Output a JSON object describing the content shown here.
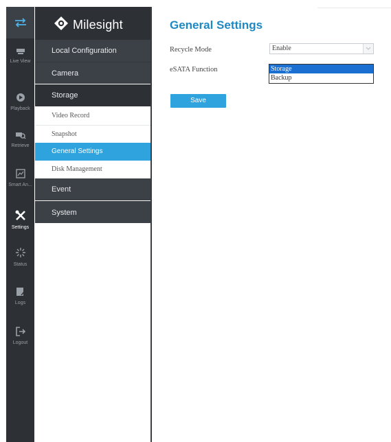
{
  "brand": {
    "name": "Milesight"
  },
  "rail": {
    "items": [
      {
        "label": "Live View",
        "icon": "live-view-icon"
      },
      {
        "label": "Playback",
        "icon": "playback-icon"
      },
      {
        "label": "Retrieve",
        "icon": "retrieve-icon"
      },
      {
        "label": "Smart An...",
        "icon": "smart-analysis-icon"
      },
      {
        "label": "Settings",
        "icon": "settings-icon",
        "active": true
      },
      {
        "label": "Status",
        "icon": "status-icon"
      },
      {
        "label": "Logs",
        "icon": "logs-icon"
      },
      {
        "label": "Logout",
        "icon": "logout-icon"
      }
    ]
  },
  "menu": {
    "groups": {
      "local_configuration": "Local Configuration",
      "camera": "Camera",
      "storage": "Storage",
      "event": "Event",
      "system": "System"
    },
    "storage_items": {
      "video_record": "Video Record",
      "snapshot": "Snapshot",
      "general_settings": "General Settings",
      "disk_management": "Disk Management"
    }
  },
  "content": {
    "title": "General Settings",
    "recycle_mode": {
      "label": "Recycle Mode",
      "value": "Enable"
    },
    "esata_function": {
      "label": "eSATA Function",
      "options": [
        "Storage",
        "Backup"
      ],
      "selected": "Storage"
    },
    "save_label": "Save"
  },
  "colors": {
    "accent": "#2fa3dd",
    "title": "#1d88c4",
    "sidebar_dark": "#2d3035",
    "sidebar_mid": "#3c4047",
    "selection": "#1a6fd0"
  }
}
